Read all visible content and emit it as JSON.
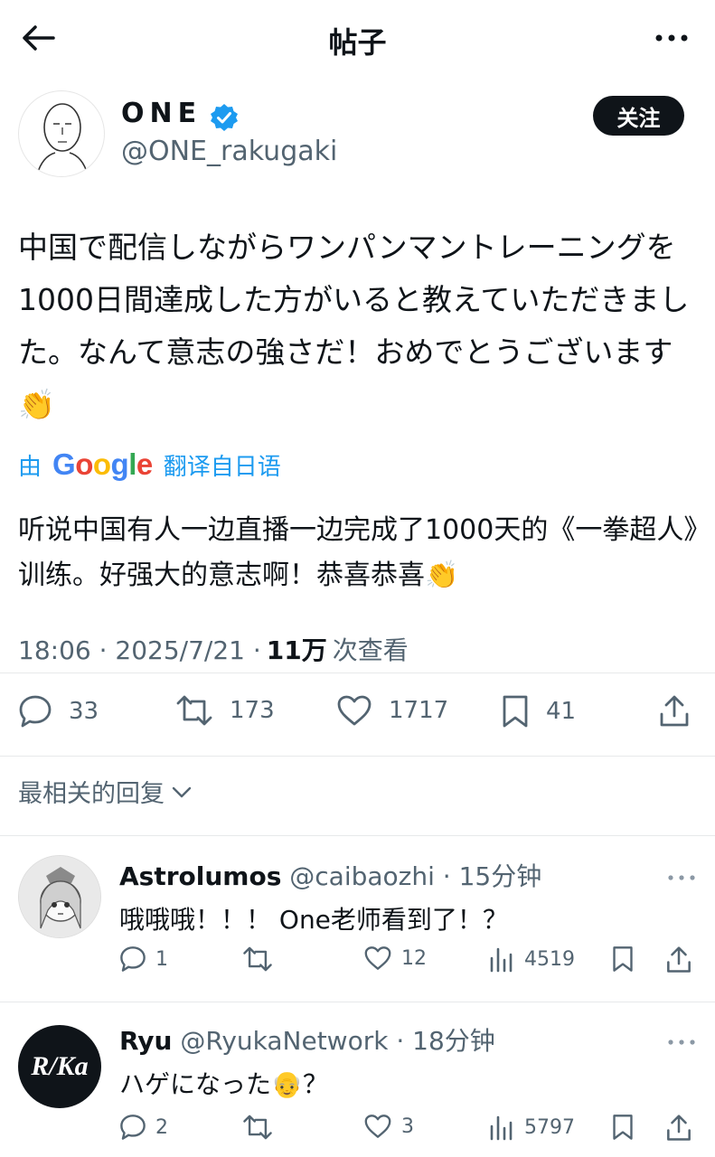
{
  "header": {
    "title": "帖子"
  },
  "author": {
    "name": "ONE",
    "handle": "@ONE_rakugaki",
    "follow_label": "关注"
  },
  "post": {
    "text": "中国で配信しながらワンパンマントレーニングを1000日間達成した方がいると教えていただきました。なんて意志の強さだ！おめでとうございます👏",
    "translate_prefix": "由",
    "translate_brand": "Google",
    "translate_suffix": "翻译自日语",
    "translated_text": "听说中国有人一边直播一边完成了1000天的《一拳超人》训练。好强大的意志啊！恭喜恭喜👏",
    "time": "18:06 · 2025/7/21 ·",
    "views": "11万",
    "views_label": "次查看",
    "replies": "33",
    "reposts": "173",
    "likes": "1717",
    "bookmarks": "41"
  },
  "replies_section": {
    "label": "最相关的回复"
  },
  "replies": [
    {
      "name": "Astrolumos",
      "handle": "@caibaozhi · 15分钟",
      "text": "哦哦哦！！！ One老师看到了！？",
      "replies": "1",
      "reposts": "",
      "likes": "12",
      "views": "4519"
    },
    {
      "name": "Ryu",
      "handle": "@RyukaNetwork · 18分钟",
      "text": "ハゲになった👴？",
      "avatar_text": "R/Ka",
      "replies": "2",
      "reposts": "",
      "likes": "3",
      "views": "5797"
    }
  ],
  "colors": {
    "text": "#0f1419",
    "secondary": "#536471",
    "link": "#1d9bf0",
    "verified": "#1d9bf0",
    "follow_bg": "#0f1419"
  }
}
